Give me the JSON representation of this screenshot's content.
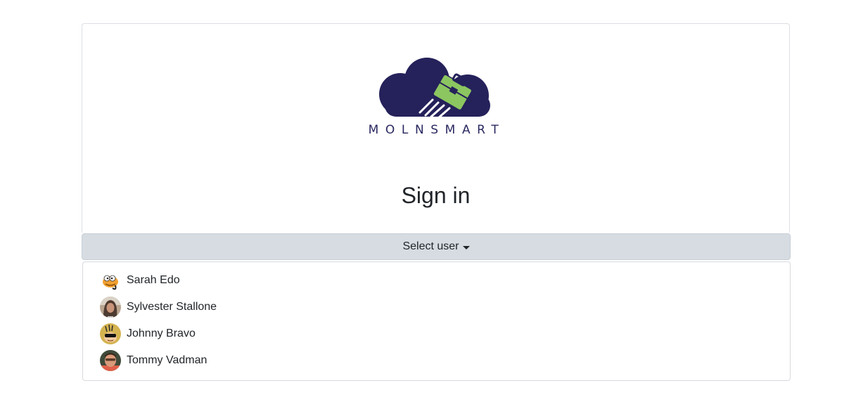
{
  "logo": {
    "wordmark": "MOLNSMART",
    "brand_color": "#25215a",
    "accent_color": "#8cc660"
  },
  "page_title": "Sign in",
  "select_user": {
    "label": "Select user",
    "icon": "caret-down-icon"
  },
  "users": [
    {
      "name": "Sarah Edo",
      "avatar": "cartoon-cat-avatar"
    },
    {
      "name": "Sylvester Stallone",
      "avatar": "photo-avatar"
    },
    {
      "name": "Johnny Bravo",
      "avatar": "cartoon-face-avatar"
    },
    {
      "name": "Tommy Vadman",
      "avatar": "photo-avatar"
    }
  ],
  "colors": {
    "button_bg": "#d6dce2",
    "border": "#dcdfe3",
    "text": "#212529"
  }
}
